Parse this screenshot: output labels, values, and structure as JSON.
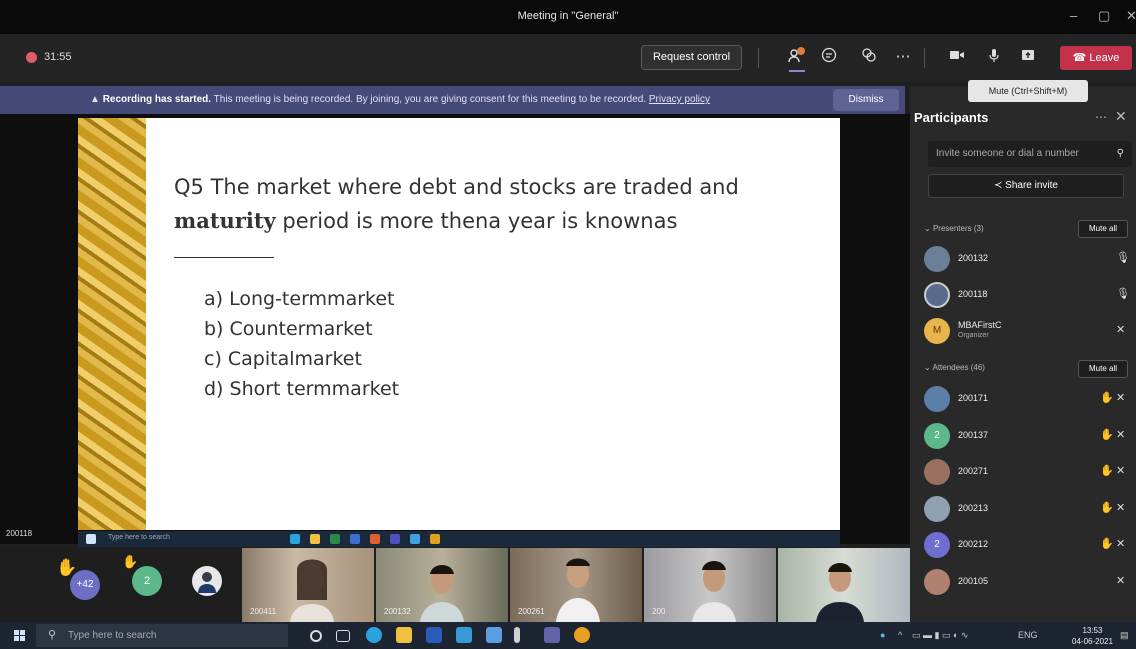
{
  "window": {
    "title": "Meeting in \"General\"",
    "controls": [
      "–",
      "▢",
      "✕"
    ]
  },
  "toolbar": {
    "timer": "31:55",
    "request_control": "Request control",
    "participants_badge": "9",
    "leave": "Leave",
    "mute_tooltip": "Mute (Ctrl+Shift+M)"
  },
  "banner": {
    "bold": "Recording has started.",
    "text": " This meeting is being recorded. By joining, you are giving consent for this meeting to be recorded. ",
    "link": "Privacy policy",
    "dismiss": "Dismiss"
  },
  "slide": {
    "q_line1": "Q5 The market where debt and stocks are traded and",
    "q_line2a": "maturity",
    "q_line2b": "  period is more thena year is knownas",
    "blank": "________.",
    "options": [
      "a) Long-termmarket",
      "b) Countermarket",
      "c) Capitalmarket",
      "d) Short termmarket"
    ]
  },
  "stage": {
    "presenter_name": "200118",
    "mini_search": "Type here to search"
  },
  "gallery": {
    "raised_count": "+42",
    "count_badge": "2",
    "tiles": [
      {
        "label": "200411"
      },
      {
        "label": "200132"
      },
      {
        "label": "200261"
      },
      {
        "label": "200"
      },
      {
        "label": ""
      }
    ]
  },
  "panel": {
    "title": "Participants",
    "invite_placeholder": "Invite someone or dial a number",
    "share_invite": "Share invite",
    "presenters_header": "Presenters (3)",
    "attendees_header": "Attendees (46)",
    "mute_all": "Mute all",
    "presenters": [
      {
        "name": "200132",
        "sub": "",
        "initial": "",
        "color": "#6b7f99"
      },
      {
        "name": "200118",
        "sub": "",
        "initial": "",
        "color": "#5a6a8a"
      },
      {
        "name": "MBAFirstC",
        "sub": "Organizer",
        "initial": "M",
        "color": "#e8b44c"
      }
    ],
    "attendees": [
      {
        "name": "200171",
        "initial": "",
        "color": "#5b7fa6"
      },
      {
        "name": "200137",
        "initial": "2",
        "color": "#5cb88a"
      },
      {
        "name": "200271",
        "initial": "",
        "color": "#9a7060"
      },
      {
        "name": "200213",
        "initial": "",
        "color": "#8fa0b0"
      },
      {
        "name": "200212",
        "initial": "2",
        "color": "#6e6ed0"
      },
      {
        "name": "200105",
        "initial": "",
        "color": "#b08070"
      }
    ]
  },
  "taskbar": {
    "search_placeholder": "Type here to search",
    "lang": "ENG",
    "time": "13:53",
    "date": "04-06-2021"
  }
}
